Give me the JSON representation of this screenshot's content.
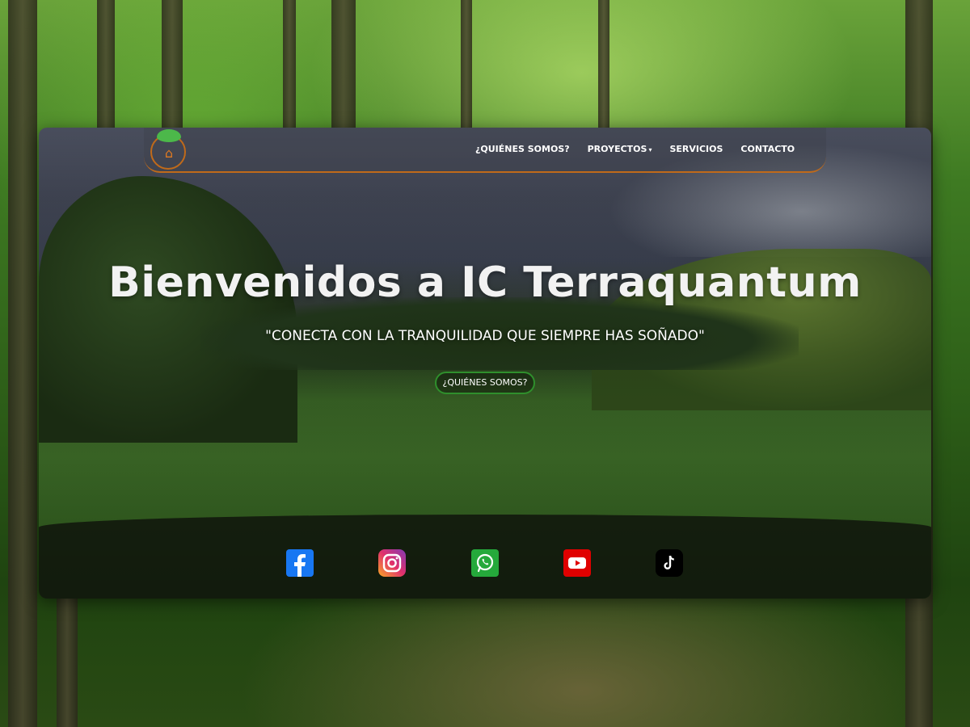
{
  "nav": {
    "items": [
      {
        "label": "¿QUIÉNES SOMOS?"
      },
      {
        "label": "PROYECTOS",
        "has_dropdown": true
      },
      {
        "label": "SERVICIOS"
      },
      {
        "label": "CONTACTO"
      }
    ]
  },
  "hero": {
    "title": "Bienvenidos a IC Terraquantum",
    "subtitle": "\"CONECTA CON LA TRANQUILIDAD QUE SIEMPRE HAS SOÑADO\"",
    "button_label": "¿QUIÉNES SOMOS?"
  },
  "social": {
    "icons": [
      "facebook-icon",
      "instagram-icon",
      "whatsapp-icon",
      "youtube-icon",
      "tiktok-icon"
    ]
  },
  "colors": {
    "accent_orange": "#c06a1a",
    "button_border_green": "#2f8f2c",
    "logo_leaf_green": "#4cb84a"
  }
}
